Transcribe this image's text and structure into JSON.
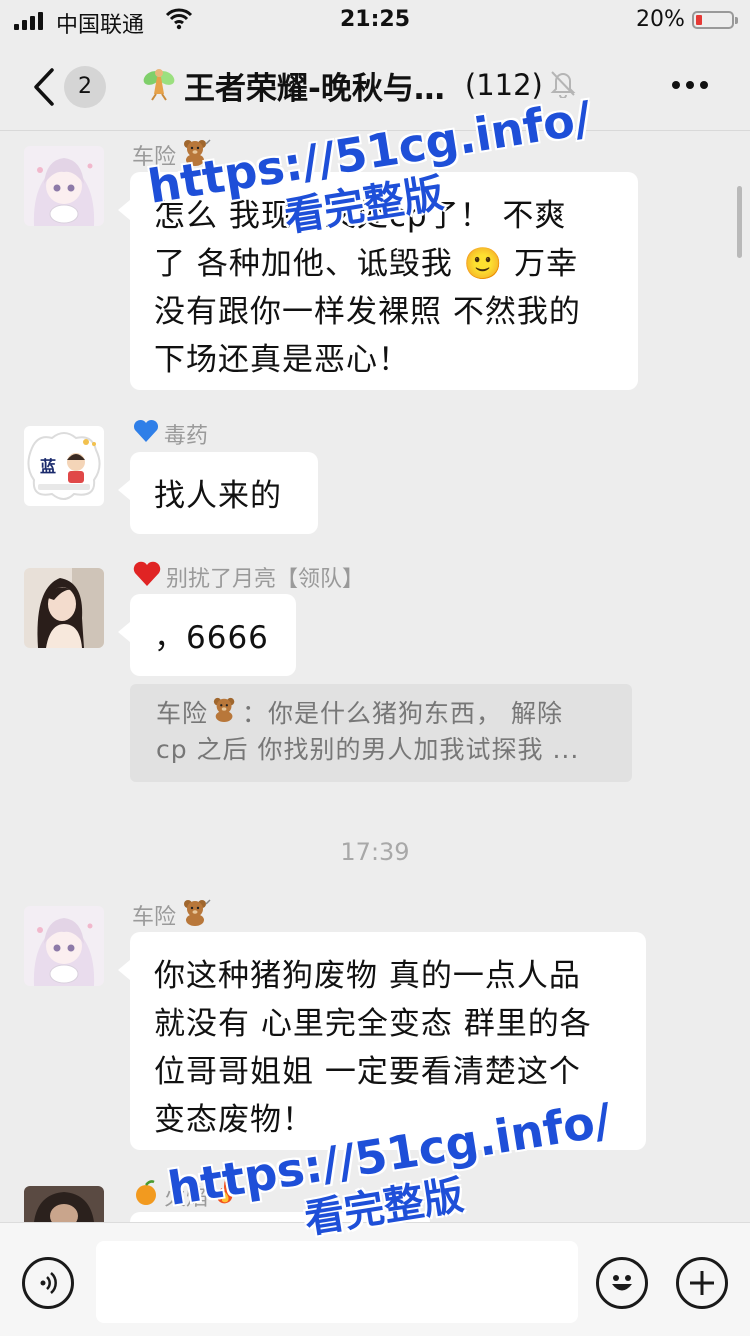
{
  "status_bar": {
    "carrier": "中国联通",
    "time": "21:25",
    "battery": "20%"
  },
  "nav": {
    "back_label": "<",
    "unread_count": "2",
    "title": "王者荣耀-晚秋与…",
    "member_count": "(112)"
  },
  "messages": [
    {
      "sender": "车险",
      "sender_suffix_icon": "teddy-bear-icon",
      "text": "怎么 我现在又处cp了！ 不爽\n了 各种加他、诋毁我 🙂 万幸\n没有跟你一样发裸照 不然我的\n下场还真是恶心！"
    },
    {
      "sender": "毒药",
      "sender_prefix_icon": "blue-heart-icon",
      "text": "找人来的"
    },
    {
      "sender": "别扰了月亮【领队】",
      "sender_prefix_icon": "red-heart-icon",
      "text": "，6666"
    }
  ],
  "quote": {
    "author": "车险",
    "text": "：你是什么猪狗东西， 解除",
    "text_line2": "cp 之后 你找别的男人加我试探我 ..."
  },
  "time_divider": "17:39",
  "messages_after": [
    {
      "sender": "车险",
      "sender_suffix_icon": "teddy-bear-icon",
      "text": "你这种猪狗废物 真的一点人品\n就没有 心里完全变态 群里的各\n位哥哥姐姐 一定要看清楚这个\n变态废物！"
    },
    {
      "sender": "火焰",
      "sender_prefix_icon": "orange-icon",
      "sender_suffix_icon": "fire-icon"
    }
  ],
  "avatar_text": {
    "signature": "蓝"
  },
  "watermarks": [
    {
      "url": "https://51cg.info/",
      "sub": "看完整版"
    },
    {
      "url": "https://51cg.info/",
      "sub": "看完整版"
    }
  ],
  "colors": {
    "watermark": "#1e4fd8",
    "page_bg": "#ededed",
    "bubble": "#ffffff"
  }
}
